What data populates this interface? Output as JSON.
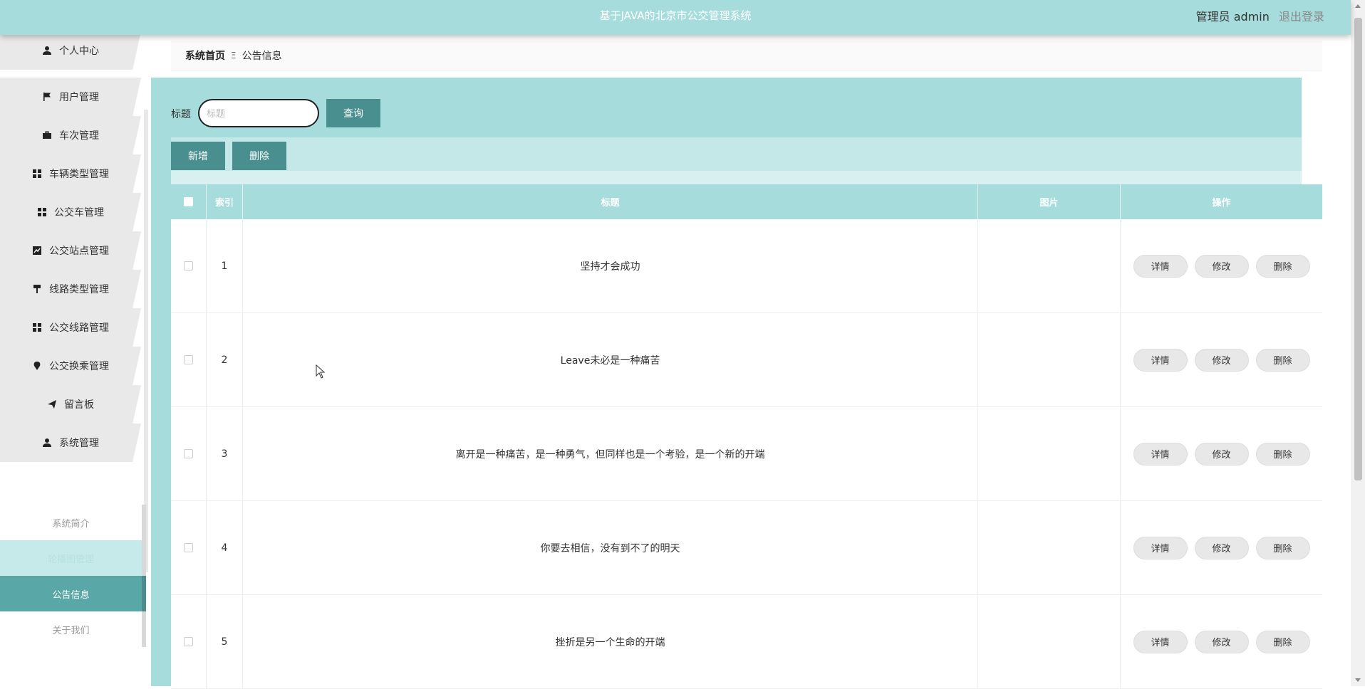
{
  "header": {
    "title": "基于JAVA的北京市公交管理系统",
    "user_label": "管理员 admin",
    "logout_label": "退出登录"
  },
  "sidebar": {
    "items": [
      {
        "label": "个人中心",
        "icon": "user-icon"
      },
      {
        "label": "用户管理",
        "icon": "flag-icon"
      },
      {
        "label": "车次管理",
        "icon": "briefcase-icon"
      },
      {
        "label": "车辆类型管理",
        "icon": "grid-icon"
      },
      {
        "label": "公交车管理",
        "icon": "grid-icon"
      },
      {
        "label": "公交站点管理",
        "icon": "chart-icon"
      },
      {
        "label": "线路类型管理",
        "icon": "paint-roller-icon"
      },
      {
        "label": "公交线路管理",
        "icon": "grid-icon"
      },
      {
        "label": "公交换乘管理",
        "icon": "pin-icon"
      },
      {
        "label": "留言板",
        "icon": "send-icon"
      },
      {
        "label": "系统管理",
        "icon": "user-icon"
      }
    ],
    "submenu": [
      {
        "label": "系统简介"
      },
      {
        "label": "轮播图管理"
      },
      {
        "label": "公告信息"
      },
      {
        "label": "关于我们"
      }
    ]
  },
  "breadcrumb": {
    "home": "系统首页",
    "separator": "Ξ",
    "current": "公告信息"
  },
  "search": {
    "label": "标题",
    "placeholder": "标题",
    "value": "",
    "query_button": "查询"
  },
  "actions": {
    "add": "新增",
    "delete": "删除"
  },
  "table": {
    "columns": [
      "索引",
      "标题",
      "图片",
      "操作"
    ],
    "rows": [
      {
        "index": "1",
        "title": "坚持才会成功"
      },
      {
        "index": "2",
        "title": "Leave未必是一种痛苦"
      },
      {
        "index": "3",
        "title": "离开是一种痛苦，是一种勇气，但同样也是一个考验，是一个新的开端"
      },
      {
        "index": "4",
        "title": "你要去相信，没有到不了的明天"
      },
      {
        "index": "5",
        "title": "挫折是另一个生命的开端"
      }
    ],
    "row_actions": {
      "detail": "详情",
      "edit": "修改",
      "delete": "删除"
    }
  },
  "colors": {
    "primary_teal": "#a6dcdc",
    "button_teal": "#4a8f8f",
    "active_submenu": "#5aa7a7"
  }
}
